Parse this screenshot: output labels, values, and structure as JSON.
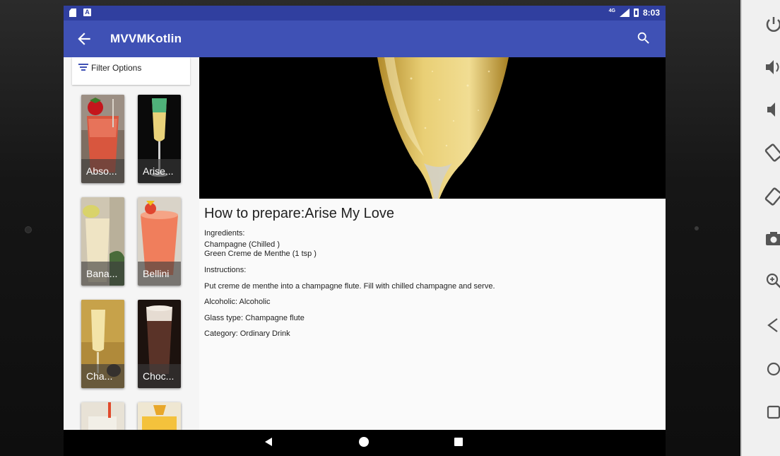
{
  "status_bar": {
    "time": "8:03",
    "network": "4G"
  },
  "app_bar": {
    "title": "MVVMKotlin",
    "back_icon": "arrow-back-icon",
    "search_icon": "search-icon"
  },
  "filter": {
    "label": "Filter Options",
    "icon": "filter-icon"
  },
  "drinks": [
    {
      "label": "Abso..."
    },
    {
      "label": "Arise..."
    },
    {
      "label": "Bana..."
    },
    {
      "label": "Bellini"
    },
    {
      "label": "Cha..."
    },
    {
      "label": "Choc..."
    }
  ],
  "detail": {
    "title": "How to prepare:Arise My Love",
    "ingredients_heading": "Ingredients:",
    "ingredients": [
      "Champagne (Chilled )",
      "Green Creme de Menthe (1 tsp )"
    ],
    "instructions_heading": "Instructions:",
    "instructions": "Put creme de menthe into a champagne flute. Fill with chilled champagne and serve.",
    "alcoholic": "Alcoholic: Alcoholic",
    "glass": "Glass type: Champagne flute",
    "category": "Category: Ordinary Drink"
  },
  "nav_bar": {
    "back": "nav-back-icon",
    "home": "nav-home-icon",
    "recents": "nav-recents-icon"
  },
  "emulator_panel": {
    "buttons": [
      "power-icon",
      "volume-up-icon",
      "volume-down-icon",
      "rotate-left-icon",
      "rotate-right-icon",
      "camera-icon",
      "zoom-icon",
      "back-icon",
      "home-icon",
      "overview-icon"
    ]
  },
  "colors": {
    "primary": "#3F51B5",
    "primary_dark": "#303F9F"
  }
}
